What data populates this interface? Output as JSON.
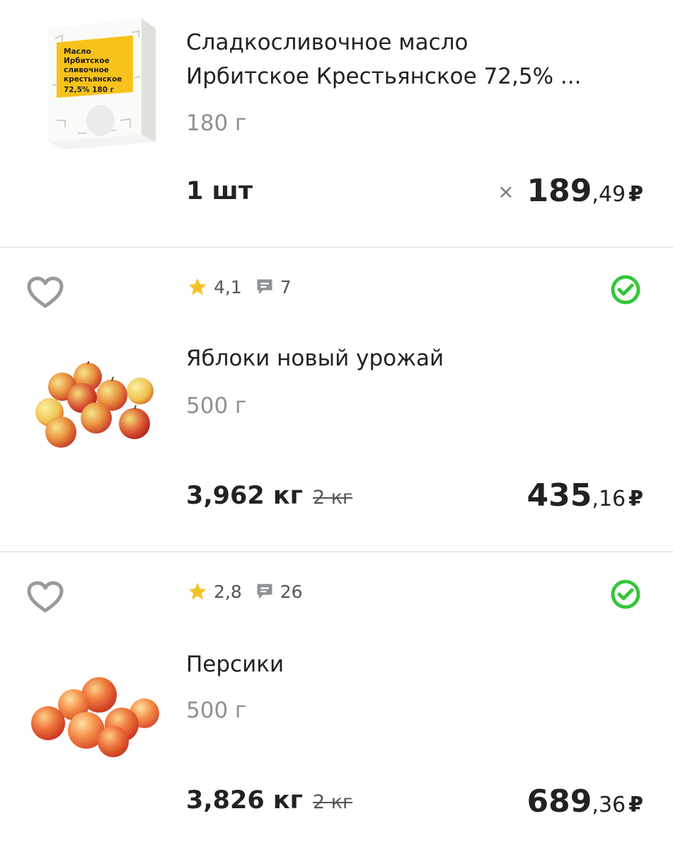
{
  "items": [
    {
      "title_line1": "Сладкосливочное масло",
      "title_line2": "Ирбитское Крестьянское 72,5% ...",
      "weight": "180 г",
      "quantity": "1 шт",
      "price_times": "×",
      "price_int": "189",
      "price_frac": ",49",
      "currency": "₽",
      "package": {
        "line1": "Масло",
        "line2": "Ирбитское",
        "line3": "сливочное",
        "line4": "крестьянское",
        "line5": "72,5%  180 г"
      }
    },
    {
      "rating": "4,1",
      "reviews": "7",
      "title": "Яблоки новый урожай",
      "weight": "500 г",
      "quantity": "3,962 кг",
      "quantity_old": "2 кг",
      "price_int": "435",
      "price_frac": ",16",
      "currency": "₽"
    },
    {
      "rating": "2,8",
      "reviews": "26",
      "title": "Персики",
      "weight": "500 г",
      "quantity": "3,826 кг",
      "quantity_old": "2 кг",
      "price_int": "689",
      "price_frac": ",36",
      "currency": "₽"
    }
  ],
  "colors": {
    "accent_green": "#37c53b",
    "star_yellow": "#f6c325",
    "divider": "#e4e9ee",
    "muted_text": "#8e9196"
  },
  "icons": [
    "heart-icon",
    "star-icon",
    "comment-icon",
    "check-circle-icon",
    "close-icon"
  ]
}
